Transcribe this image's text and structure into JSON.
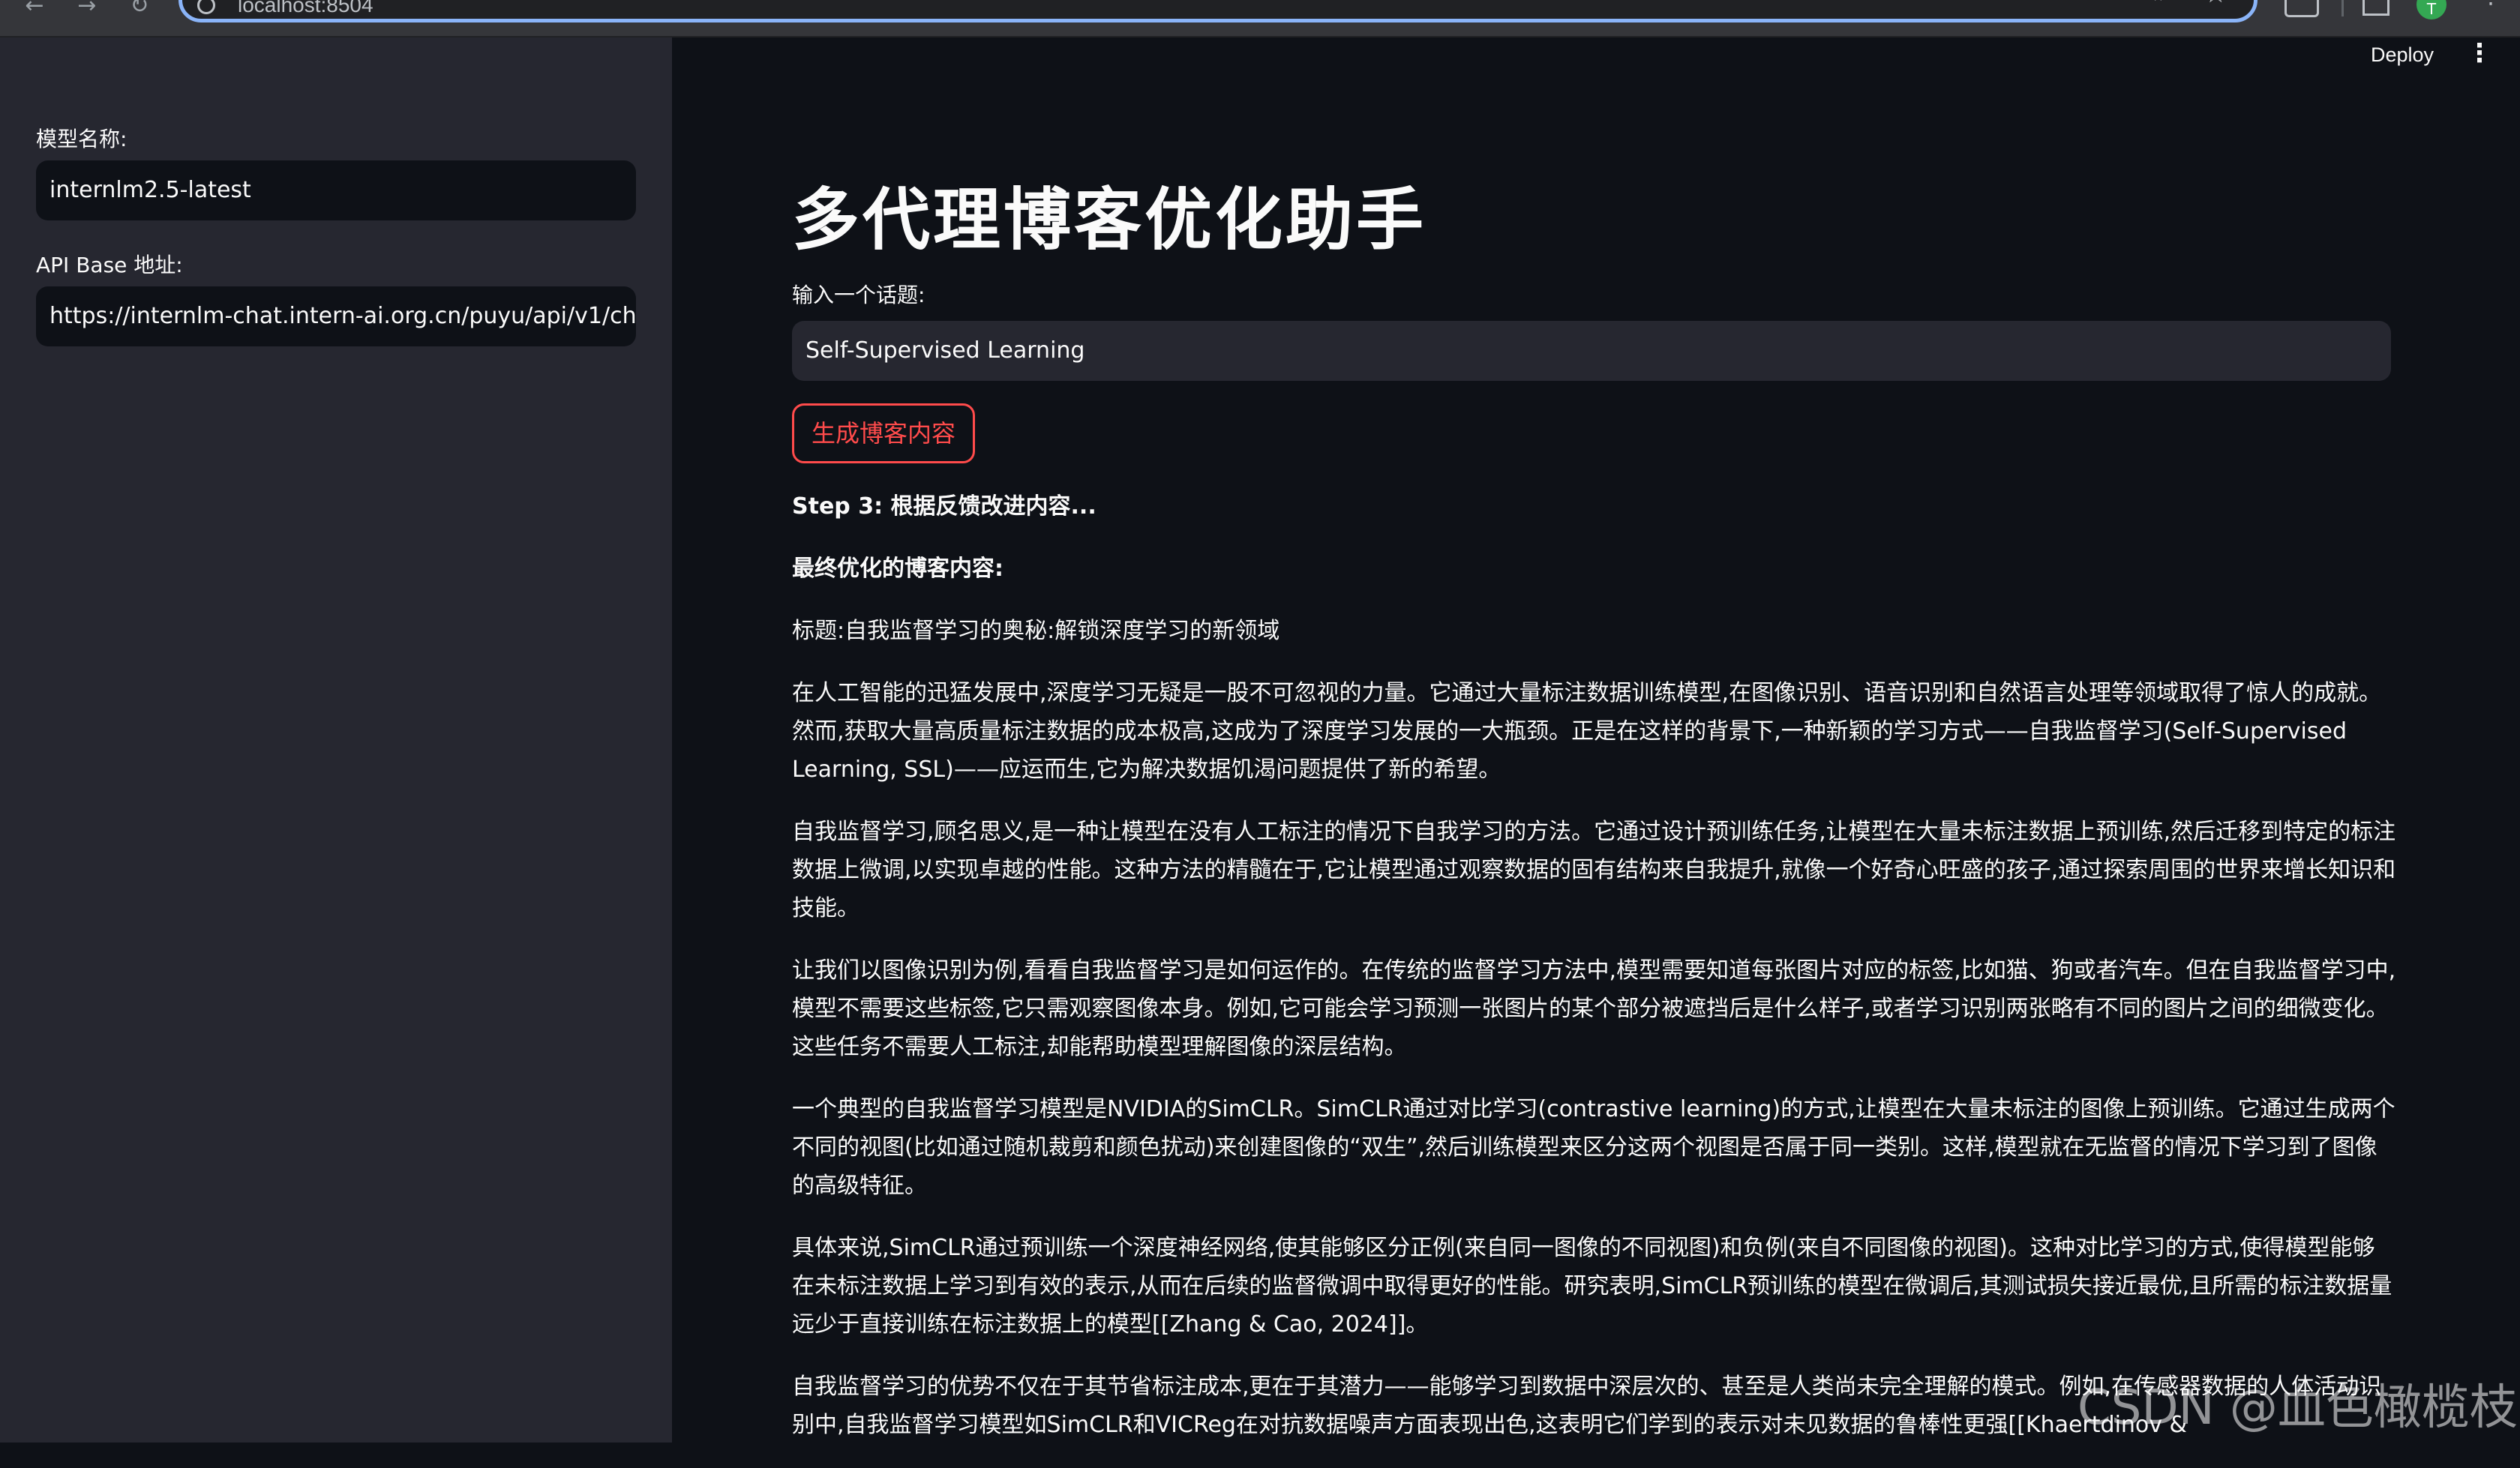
{
  "browser": {
    "url": "localhost:8504",
    "profile_initial": "T"
  },
  "sidebar": {
    "model_label": "模型名称:",
    "model_value": "internlm2.5-latest",
    "api_label": "API Base 地址:",
    "api_value": "https://internlm-chat.intern-ai.org.cn/puyu/api/v1/chat/c"
  },
  "header": {
    "deploy_label": "Deploy"
  },
  "main": {
    "title": "多代理博客优化助手",
    "topic_label": "输入一个话题:",
    "topic_value": "Self-Supervised Learning",
    "generate_label": "生成博客内容",
    "step_text": "Step 3: 根据反馈改进内容...",
    "final_heading": "最终优化的博客内容:",
    "blog_title": "标题:自我监督学习的奥秘:解锁深度学习的新领域",
    "paragraphs": [
      "在人工智能的迅猛发展中,深度学习无疑是一股不可忽视的力量。它通过大量标注数据训练模型,在图像识别、语音识别和自然语言处理等领域取得了惊人的成就。然而,获取大量高质量标注数据的成本极高,这成为了深度学习发展的一大瓶颈。正是在这样的背景下,一种新颖的学习方式——自我监督学习(Self-Supervised Learning, SSL)——应运而生,它为解决数据饥渴问题提供了新的希望。",
      "自我监督学习,顾名思义,是一种让模型在没有人工标注的情况下自我学习的方法。它通过设计预训练任务,让模型在大量未标注数据上预训练,然后迁移到特定的标注数据上微调,以实现卓越的性能。这种方法的精髓在于,它让模型通过观察数据的固有结构来自我提升,就像一个好奇心旺盛的孩子,通过探索周围的世界来增长知识和技能。",
      "让我们以图像识别为例,看看自我监督学习是如何运作的。在传统的监督学习方法中,模型需要知道每张图片对应的标签,比如猫、狗或者汽车。但在自我监督学习中,模型不需要这些标签,它只需观察图像本身。例如,它可能会学习预测一张图片的某个部分被遮挡后是什么样子,或者学习识别两张略有不同的图片之间的细微变化。这些任务不需要人工标注,却能帮助模型理解图像的深层结构。",
      "一个典型的自我监督学习模型是NVIDIA的SimCLR。SimCLR通过对比学习(contrastive learning)的方式,让模型在大量未标注的图像上预训练。它通过生成两个不同的视图(比如通过随机裁剪和颜色扰动)来创建图像的“双生”,然后训练模型来区分这两个视图是否属于同一类别。这样,模型就在无监督的情况下学习到了图像的高级特征。",
      "具体来说,SimCLR通过预训练一个深度神经网络,使其能够区分正例(来自同一图像的不同视图)和负例(来自不同图像的视图)。这种对比学习的方式,使得模型能够在未标注数据上学习到有效的表示,从而在后续的监督微调中取得更好的性能。研究表明,SimCLR预训练的模型在微调后,其测试损失接近最优,且所需的标注数据量远少于直接训练在标注数据上的模型[[Zhang & Cao, 2024]]。",
      "自我监督学习的优势不仅在于其节省标注成本,更在于其潜力——能够学习到数据中深层次的、甚至是人类尚未完全理解的模式。例如,在传感器数据的人体活动识别中,自我监督学习模型如SimCLR和VICReg在对抗数据噪声方面表现出色,这表明它们学到的表示对未见数据的鲁棒性更强[[Khaertdinov &"
    ]
  },
  "watermark": "CSDN @血色橄榄枝"
}
